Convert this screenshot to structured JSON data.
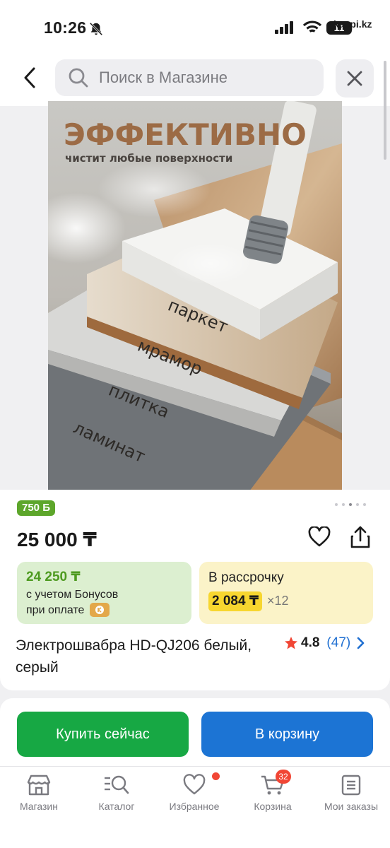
{
  "status_bar": {
    "time": "10:26",
    "carrier": "kaspi.kz",
    "battery": "11"
  },
  "header": {
    "search_placeholder": "Поиск в Магазине"
  },
  "product_image": {
    "headline": "ЭФФЕКТИВНО",
    "subline": "чистит любые поверхности",
    "surfaces": [
      "паркет",
      "мрамор",
      "плитка",
      "ламинат"
    ]
  },
  "details": {
    "bonus_badge": "750 Б",
    "price": "25 000 ₸",
    "bonus_card": {
      "price": "24 250 ₸",
      "line1": "с учетом Бонусов",
      "line2": "при оплате"
    },
    "installment_card": {
      "label": "В рассрочку",
      "amount": "2 084 ₸",
      "multiplier": "×12"
    },
    "title": "Электрошвабра HD-QJ206 белый, серый",
    "rating": "4.8",
    "reviews": "(47)"
  },
  "actions": {
    "buy_now": "Купить сейчас",
    "to_cart": "В корзину"
  },
  "tabbar": {
    "items": [
      {
        "label": "Магазин"
      },
      {
        "label": "Каталог"
      },
      {
        "label": "Избранное"
      },
      {
        "label": "Корзина",
        "badge": "32"
      },
      {
        "label": "Мои заказы"
      }
    ]
  },
  "colors": {
    "accent_green": "#17a844",
    "accent_blue": "#1c74d4",
    "badge_red": "#f14635",
    "installment_yellow": "#f7d62f"
  }
}
